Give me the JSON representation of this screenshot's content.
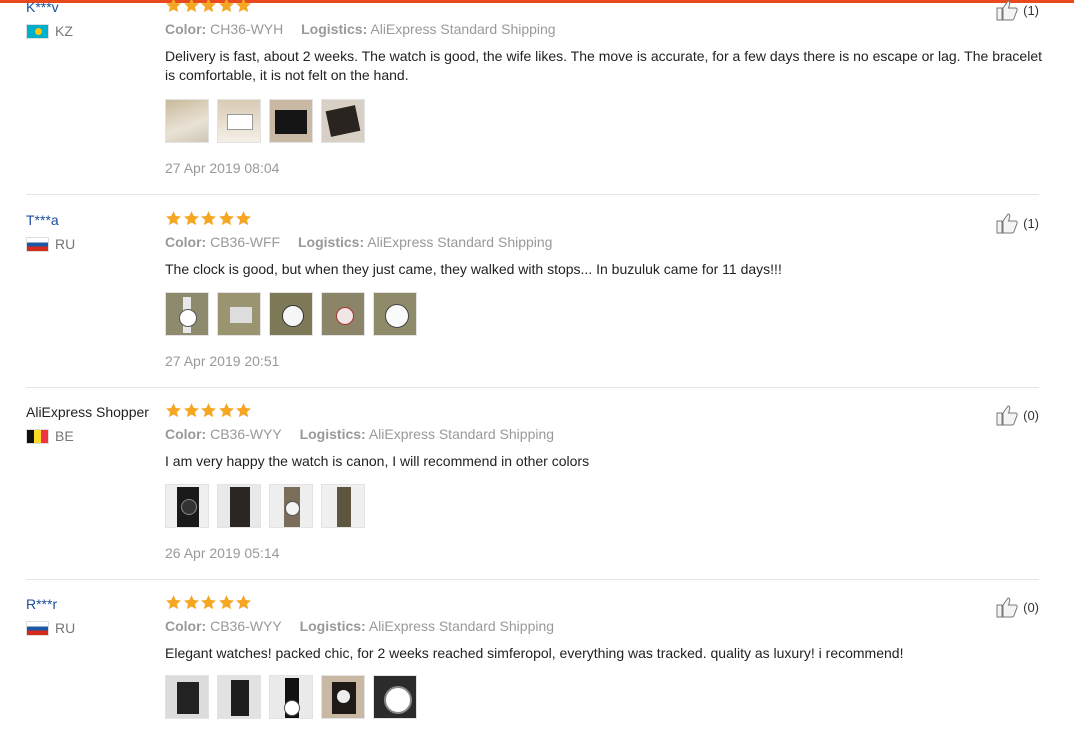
{
  "reviews": [
    {
      "user": "K***v",
      "country_code": "KZ",
      "flag": "kz",
      "user_style": "link",
      "stars": 5,
      "color_label": "Color:",
      "color_value": "CH36-WYH",
      "logistics_label": "Logistics:",
      "logistics_value": "AliExpress Standard Shipping",
      "text": "Delivery is fast, about 2 weeks. The watch is good, the wife likes. The move is accurate, for a few days there is no escape or lag. The bracelet is comfortable, it is not felt on the hand.",
      "photos": [
        "photo-1",
        "photo-2",
        "photo-3",
        "photo-4"
      ],
      "date": "27 Apr 2019 08:04",
      "likes": "(1)"
    },
    {
      "user": "T***a",
      "country_code": "RU",
      "flag": "ru",
      "user_style": "link",
      "stars": 5,
      "color_label": "Color:",
      "color_value": "CB36-WFF",
      "logistics_label": "Logistics:",
      "logistics_value": "AliExpress Standard Shipping",
      "text": "The clock is good, but when they just came, they walked with stops... In buzuluk came for 11 days!!!",
      "photos": [
        "photo-1",
        "photo-2",
        "photo-3",
        "photo-4",
        "photo-5"
      ],
      "date": "27 Apr 2019 20:51",
      "likes": "(1)"
    },
    {
      "user": "AliExpress Shopper",
      "country_code": "BE",
      "flag": "be",
      "user_style": "plain",
      "stars": 5,
      "color_label": "Color:",
      "color_value": "CB36-WYY",
      "logistics_label": "Logistics:",
      "logistics_value": "AliExpress Standard Shipping",
      "text": "I am very happy the watch is canon, I will recommend in other colors",
      "photos": [
        "photo-1",
        "photo-2",
        "photo-3",
        "photo-4"
      ],
      "date": "26 Apr 2019 05:14",
      "likes": "(0)"
    },
    {
      "user": "R***r",
      "country_code": "RU",
      "flag": "ru",
      "user_style": "link",
      "stars": 5,
      "color_label": "Color:",
      "color_value": "CB36-WYY",
      "logistics_label": "Logistics:",
      "logistics_value": "AliExpress Standard Shipping",
      "text": "Elegant watches! packed chic, for 2 weeks reached simferopol, everything was tracked. quality as luxury! i recommend!",
      "photos": [
        "photo-1",
        "photo-2",
        "photo-3",
        "photo-4",
        "photo-5"
      ],
      "date": "",
      "likes": "(0)"
    }
  ],
  "colors": {
    "star": "#f5a623",
    "link": "#1a4d9a",
    "muted": "#999999",
    "accent_line": "#e8491d"
  }
}
